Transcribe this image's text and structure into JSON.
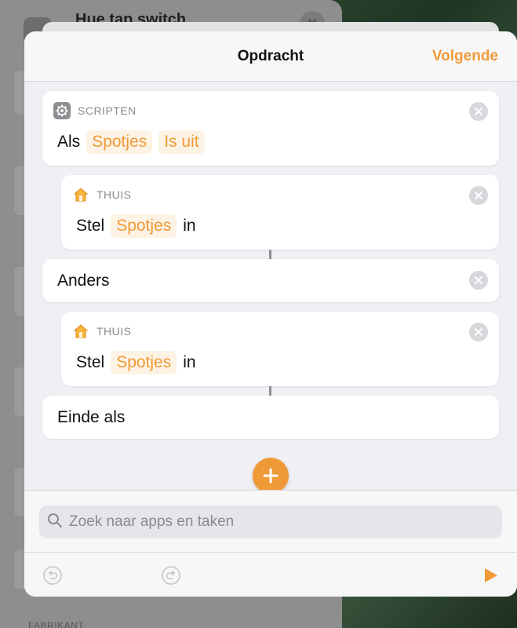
{
  "background": {
    "title": "Hue tap switch",
    "section_label": "FABRIKANT"
  },
  "header": {
    "title": "Opdracht",
    "next_label": "Volgende"
  },
  "actions": [
    {
      "app_label": "SCRIPTEN",
      "words": [
        "Als"
      ],
      "tokens": [
        "Spotjes",
        "Is uit"
      ]
    },
    {
      "app_label": "THUIS",
      "prefix": "Stel",
      "token": "Spotjes",
      "suffix": "in"
    },
    {
      "text": "Anders"
    },
    {
      "app_label": "THUIS",
      "prefix": "Stel",
      "token": "Spotjes",
      "suffix": "in"
    },
    {
      "text": "Einde als"
    }
  ],
  "search": {
    "placeholder": "Zoek naar apps en taken",
    "value": ""
  },
  "colors": {
    "accent": "#f09a37",
    "token_bg": "#fdf3e4",
    "panel_bg": "#efeff4"
  },
  "icons": {
    "scripts": "gear-icon",
    "home": "house-icon",
    "remove": "close-icon",
    "add": "plus-icon",
    "search": "search-icon",
    "undo": "undo-icon",
    "redo": "redo-icon",
    "run": "play-icon"
  }
}
